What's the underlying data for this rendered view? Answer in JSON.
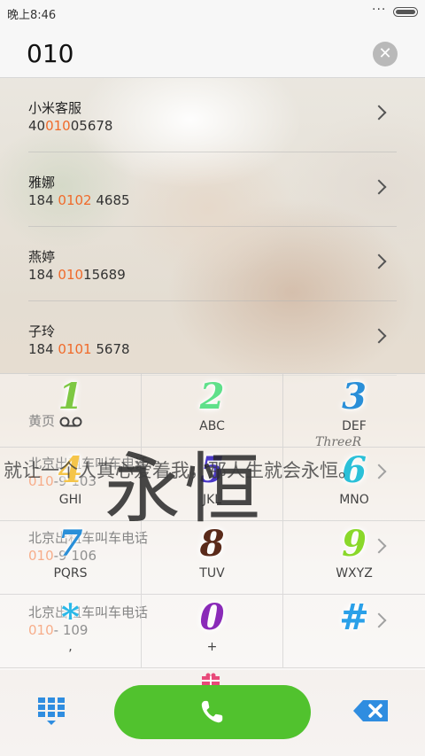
{
  "status_bar": {
    "time": "晚上8:46",
    "menu_dots": "···",
    "icons": [
      "battery-icon"
    ]
  },
  "dial_input": {
    "number": "010",
    "clear_icon": "close-circle-icon"
  },
  "matches": [
    {
      "name": "小米客服",
      "num_before": "40",
      "num_match": "010",
      "num_after": "05678"
    },
    {
      "name": "雅娜",
      "num_before": "184 ",
      "num_match": "0102",
      "num_after": " 4685"
    },
    {
      "name": "燕婷",
      "num_before": "184 ",
      "num_match": "010",
      "num_after": "15689"
    },
    {
      "name": "子玲",
      "num_before": "184 ",
      "num_match": "0101",
      "num_after": " 5678"
    }
  ],
  "more_results": {
    "yellow_pages_label": "黄页",
    "rows": [
      {
        "name": "北京出租车叫车电话",
        "num_match": "010",
        "num_after": "-9  103"
      },
      {
        "name": "北京出租车叫车电话",
        "num_match": "010",
        "num_after": "-9  106"
      },
      {
        "name": "北京出租车叫车电话",
        "num_match": "010",
        "num_after": "-   109"
      }
    ]
  },
  "watermark": {
    "calligraphy": "永恒",
    "sentence": "就让一个人真心爱着我，那人生就会永恒。",
    "signature": "ThreeR"
  },
  "keypad": {
    "keys": [
      {
        "digit": "1",
        "letters": "",
        "color": "#7ec843",
        "icon": "voicemail-icon"
      },
      {
        "digit": "2",
        "letters": "ABC",
        "color": "#5fe08a"
      },
      {
        "digit": "3",
        "letters": "DEF",
        "color": "#2a8fd8"
      },
      {
        "digit": "4",
        "letters": "GHI",
        "color": "#f5c54a"
      },
      {
        "digit": "5",
        "letters": "JKL",
        "color": "#4b39c8"
      },
      {
        "digit": "6",
        "letters": "MNO",
        "color": "#2ac0d8"
      },
      {
        "digit": "7",
        "letters": "PQRS",
        "color": "#2a8fd8"
      },
      {
        "digit": "8",
        "letters": "TUV",
        "color": "#5a2a1a"
      },
      {
        "digit": "9",
        "letters": "WXYZ",
        "color": "#8ad82a"
      },
      {
        "digit": "*",
        "letters": ",",
        "color": "#2ab8e8"
      },
      {
        "digit": "0",
        "letters": "+",
        "color": "#8a2ab8"
      },
      {
        "digit": "#",
        "letters": "",
        "color": "#2aa0e8"
      }
    ]
  },
  "bottom_bar": {
    "keypad_toggle_icon": "dialpad-icon",
    "call_icon": "phone-icon",
    "delete_icon": "backspace-icon",
    "call_color": "#51c22e"
  }
}
